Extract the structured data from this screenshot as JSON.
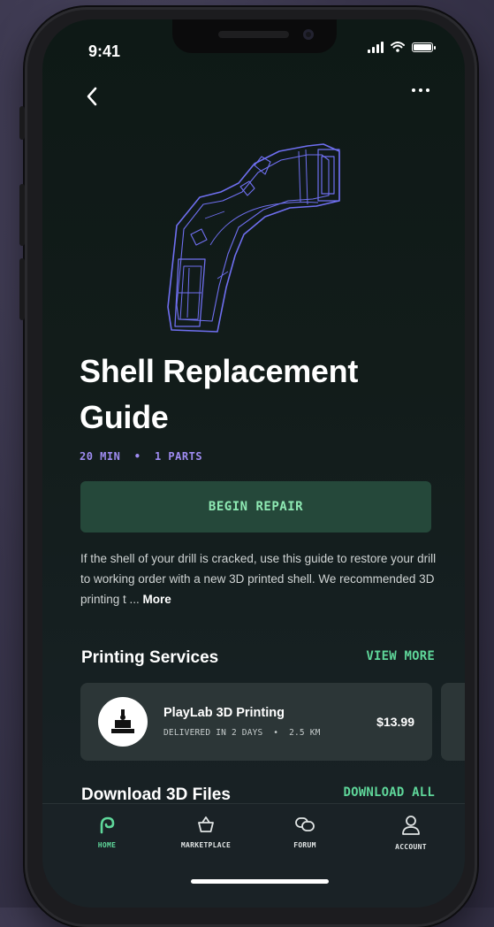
{
  "status_bar": {
    "time": "9:41"
  },
  "guide": {
    "title_line1": "Shell Replacement",
    "title_line2": "Guide",
    "meta": "20 MIN  •  1 PARTS",
    "begin_label": "BEGIN REPAIR",
    "description": "If the shell of your drill is cracked, use this guide to restore your drill to working order with a new 3D printed shell. We recommended 3D printing t ... ",
    "description_more": "More"
  },
  "printing_services": {
    "title": "Printing Services",
    "link": "VIEW MORE",
    "items": [
      {
        "name": "PlayLab 3D Printing",
        "details": "DELIVERED IN 2 DAYS  •  2.5 KM",
        "price": "$13.99"
      }
    ]
  },
  "downloads": {
    "title": "Download 3D Files",
    "link": "DOWNLOAD ALL"
  },
  "tabs": [
    {
      "label": "HOME",
      "icon": "home-icon",
      "active": true
    },
    {
      "label": "MARKETPLACE",
      "icon": "basket-icon",
      "active": false
    },
    {
      "label": "FORUM",
      "icon": "chat-icon",
      "active": false
    },
    {
      "label": "ACCOUNT",
      "icon": "user-icon",
      "active": false
    }
  ],
  "colors": {
    "accent_green": "#5fd79a",
    "meta_purple": "#9f8cf2",
    "begin_bg": "#25483a",
    "screen_bg": "#121c1a",
    "hero_line": "#6f6ff0"
  }
}
